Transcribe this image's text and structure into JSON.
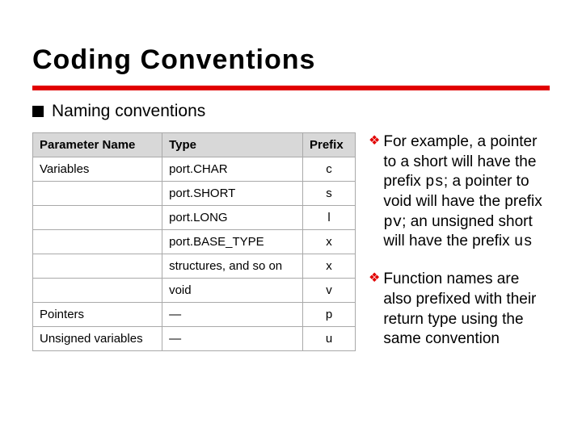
{
  "title": "Coding Conventions",
  "bullet": "Naming conventions",
  "table": {
    "headers": [
      "Parameter Name",
      "Type",
      "Prefix"
    ],
    "rows": [
      {
        "name": "Variables",
        "type": "port.CHAR",
        "prefix": "c"
      },
      {
        "name": "",
        "type": "port.SHORT",
        "prefix": "s"
      },
      {
        "name": "",
        "type": "port.LONG",
        "prefix": "l"
      },
      {
        "name": "",
        "type": "port.BASE_TYPE",
        "prefix": "x"
      },
      {
        "name": "",
        "type": "structures, and so on",
        "prefix": "x"
      },
      {
        "name": "",
        "type": "void",
        "prefix": "v"
      },
      {
        "name": "Pointers",
        "type": "—",
        "prefix": "p"
      },
      {
        "name": "Unsigned variables",
        "type": "—",
        "prefix": "u"
      }
    ]
  },
  "note1": {
    "t1": "For example, a pointer to a short will have the prefix ",
    "c1": "ps",
    "t2": "; a pointer to void will have the prefix ",
    "c2": "pv",
    "t3": "; an unsigned short will have the prefix ",
    "c3": "us"
  },
  "note2": "Function names are also prefixed with their return type using the same convention"
}
